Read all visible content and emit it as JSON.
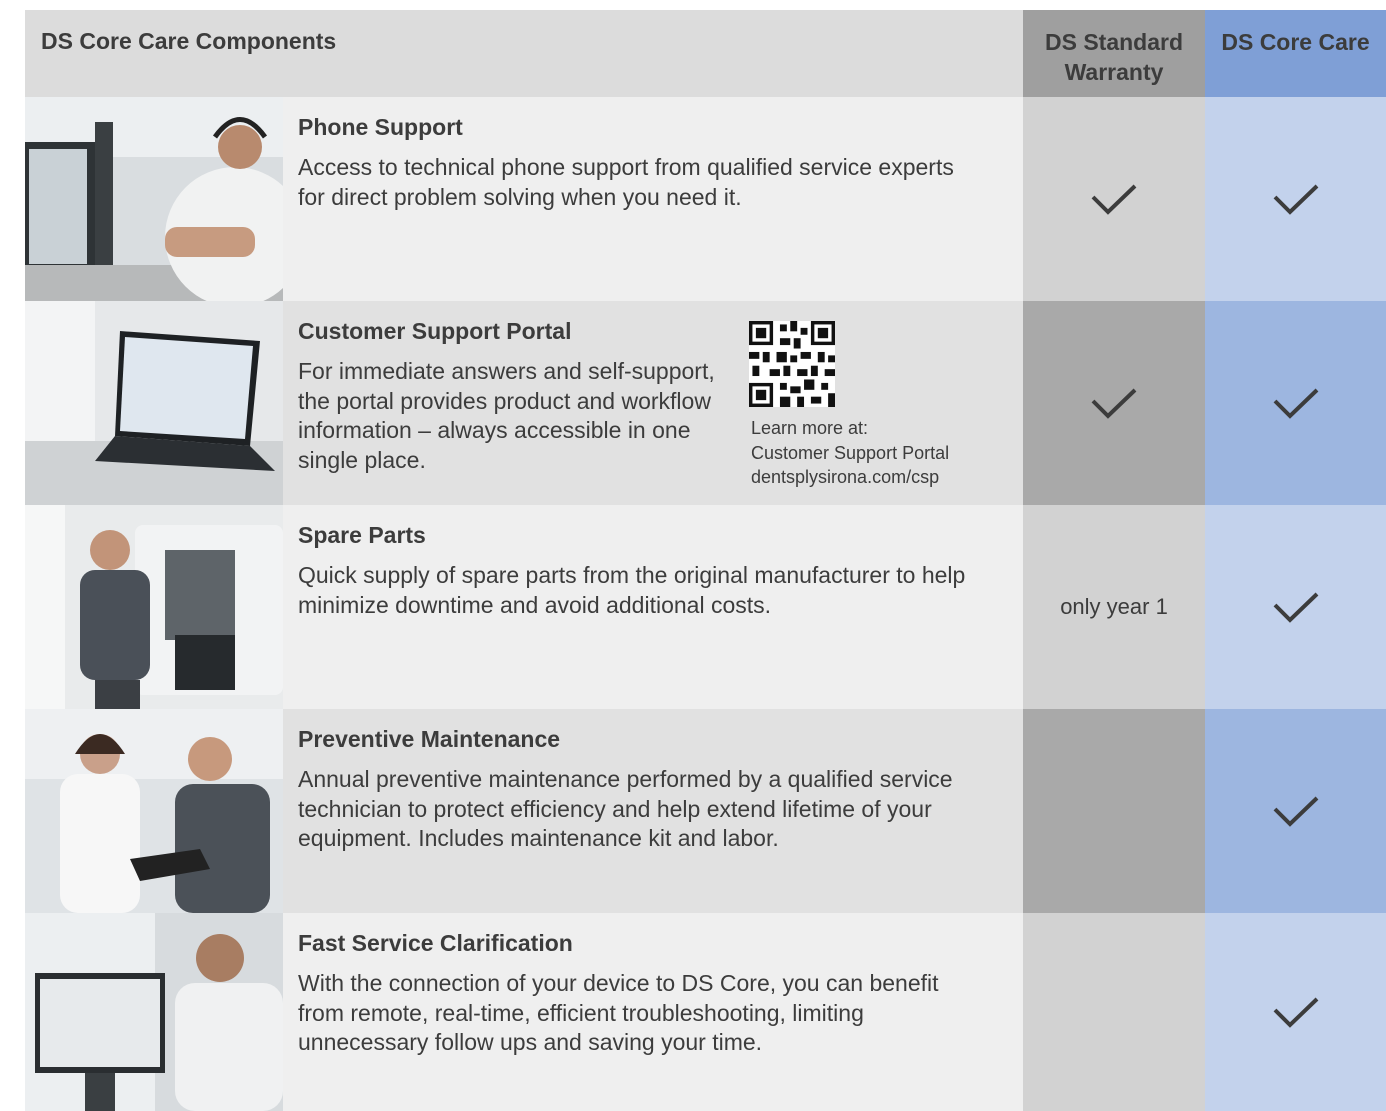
{
  "header": {
    "title": "DS Core Care Components",
    "col_warranty": "DS Standard Warranty",
    "col_care": "DS Core Care"
  },
  "rows": [
    {
      "title": "Phone Support",
      "text": "Access to technical phone support from qualified service experts for direct problem solving when you need it.",
      "photo": "man-with-headset-at-desk",
      "warranty": "check-icon",
      "care": "check-icon"
    },
    {
      "title": "Customer Support Portal",
      "text": "For immediate answers and self-support, the portal provides product and workflow information – always accessible in one single place.",
      "photo": "laptop-on-desk",
      "qr_label_1": "Learn more at:",
      "qr_label_2": "Customer Support Portal",
      "qr_label_3": "dentsplysirona.com/csp",
      "warranty": "check-icon",
      "care": "check-icon"
    },
    {
      "title": "Spare Parts",
      "text": "Quick supply of spare parts from the original manufacturer to help minimize downtime and avoid additional costs.",
      "photo": "technician-servicing-machine",
      "warranty_note": "only year 1",
      "care": "check-icon"
    },
    {
      "title": "Preventive Maintenance",
      "text": "Annual preventive maintenance performed by a qualified service technician to protect efficiency and help extend lifetime of your equipment. Includes maintenance kit and labor.",
      "photo": "two-people-with-tablet",
      "warranty": "",
      "care": "check-icon"
    },
    {
      "title": "Fast Service Clarification",
      "text": "With the connection of your device to DS Core, you can benefit from remote, real-time, efficient troubleshooting, limiting unnecessary follow ups and saving your time.",
      "photo": "man-with-headset-at-monitor",
      "warranty": "",
      "care": "check-icon"
    }
  ],
  "colors": {
    "header_grey": "#dcdcdc",
    "warranty_header": "#9f9f9f",
    "care_header": "#7f9fd6",
    "care_light": "#c3d2ec",
    "care_dark": "#9db6e0",
    "text": "#3c3c3c"
  }
}
